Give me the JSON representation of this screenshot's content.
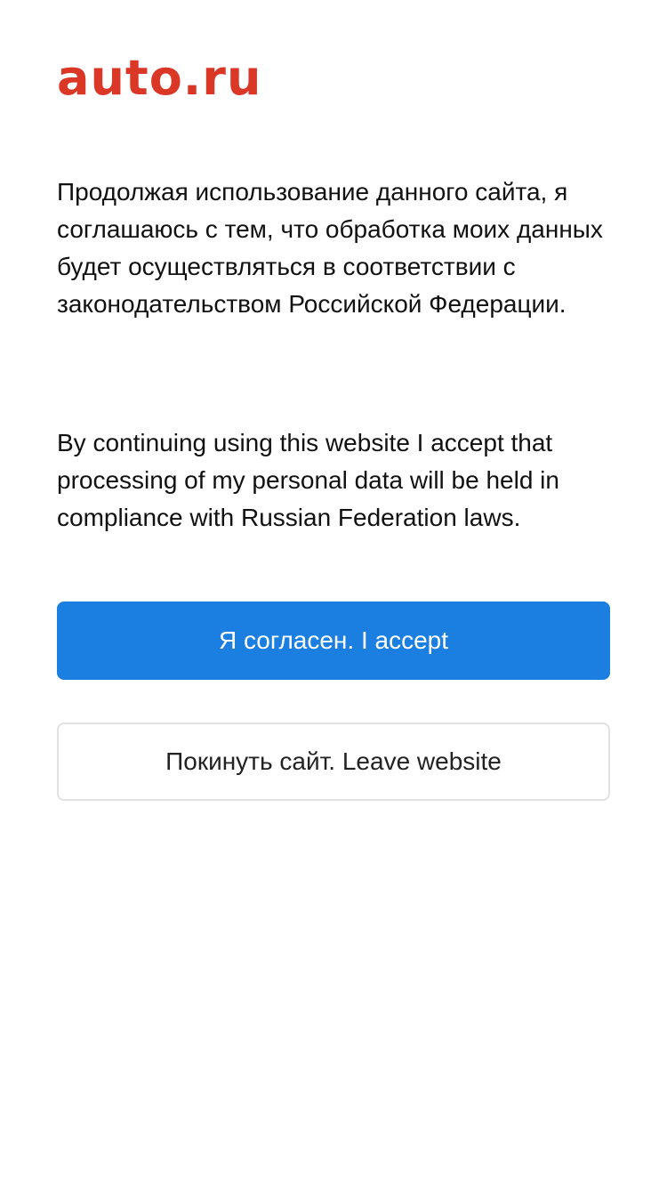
{
  "brand": {
    "logo_text": "auto.ru",
    "logo_color": "#db3727"
  },
  "consent": {
    "text_ru": "Продолжая использование данного сайта, я соглашаюсь с тем, что обработка моих данных будет осуществляться в соответствии с законодательством Российской Федерации.",
    "text_en": "By continuing using this website I accept that processing of my personal data will be held in compliance with Russian Federation laws."
  },
  "actions": {
    "accept_label": "Я согласен. I accept",
    "leave_label": "Покинуть сайт. Leave website"
  },
  "colors": {
    "accept_button_bg": "#1a7fe1",
    "leave_button_border": "#e2e2e2"
  }
}
